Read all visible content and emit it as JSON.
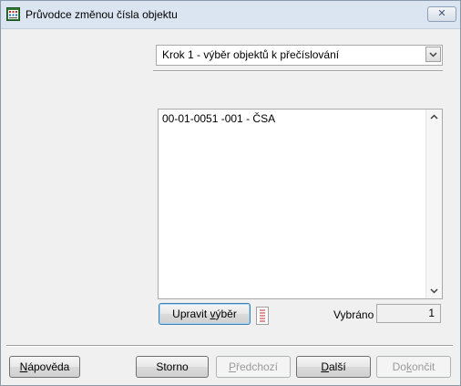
{
  "window": {
    "title": "Průvodce změnou čísla objektu",
    "close_label": "✕"
  },
  "step_dropdown": {
    "value": "Krok 1 - výběr objektů k přečíslování"
  },
  "list": {
    "items": [
      "00-01-0051 -001 - ČSA"
    ]
  },
  "upravit_button": {
    "prefix": "Upravit ",
    "underlined": "v",
    "suffix": "ýběr"
  },
  "selected": {
    "label": "Vybráno",
    "value": "1"
  },
  "footer": {
    "help": {
      "underlined": "N",
      "rest": "ápověda",
      "enabled": true
    },
    "cancel": {
      "label": "Storno",
      "enabled": true
    },
    "previous": {
      "underlined": "P",
      "rest": "ředchozí",
      "enabled": false
    },
    "next": {
      "underlined": "D",
      "rest": "alší",
      "enabled": true
    },
    "finish": {
      "prefix": "Do",
      "underlined": "k",
      "rest": "ončit",
      "enabled": false
    }
  },
  "colors": {
    "titlebar": "#dbe5f1",
    "window_bg": "#f0f0f0",
    "default_button_border": "#3c7fb1"
  }
}
